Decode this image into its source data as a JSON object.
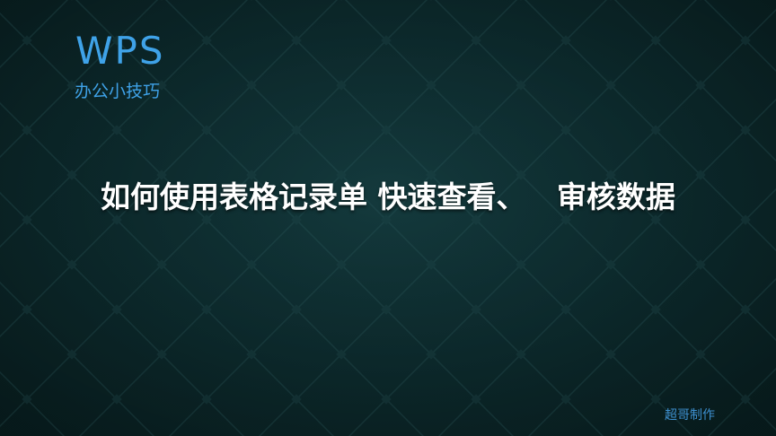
{
  "logo": {
    "title": "WPS",
    "subtitle": "办公小技巧"
  },
  "slide": {
    "title": "如何使用表格记录单 快速查看、   审核数据",
    "credit": "超哥制作"
  },
  "colors": {
    "background": "#0f3235",
    "pattern_line": "#1b4447",
    "accent_blue": "#3fa2e8",
    "title_text": "#ffffff"
  }
}
